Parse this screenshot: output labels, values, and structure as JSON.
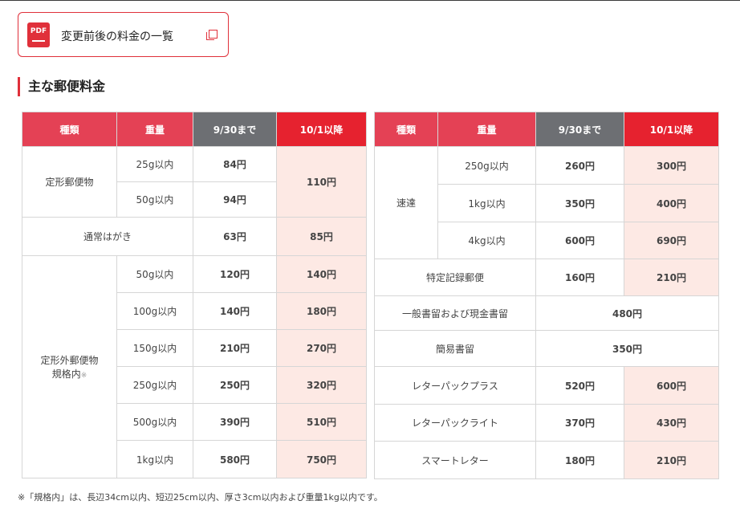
{
  "pdf_link": {
    "icon_text": "PDF",
    "label": "変更前後の料金の一覧"
  },
  "section": {
    "title": "主な郵便料金"
  },
  "headers": {
    "type": "種類",
    "weight": "重量",
    "old": "9/30まで",
    "new": "10/1以降"
  },
  "left": {
    "teikei": {
      "name": "定形郵便物",
      "rows": [
        {
          "weight": "25g以内",
          "old": "84円"
        },
        {
          "weight": "50g以内",
          "old": "94円"
        }
      ],
      "new": "110円"
    },
    "hagaki": {
      "name": "通常はがき",
      "old": "63円",
      "new": "85円"
    },
    "teikeigai": {
      "name_line1": "定形外郵便物",
      "name_line2": "規格内",
      "note_mark": "※",
      "rows": [
        {
          "weight": "50g以内",
          "old": "120円",
          "new": "140円"
        },
        {
          "weight": "100g以内",
          "old": "140円",
          "new": "180円"
        },
        {
          "weight": "150g以内",
          "old": "210円",
          "new": "270円"
        },
        {
          "weight": "250g以内",
          "old": "250円",
          "new": "320円"
        },
        {
          "weight": "500g以内",
          "old": "390円",
          "new": "510円"
        },
        {
          "weight": "1kg以内",
          "old": "580円",
          "new": "750円"
        }
      ]
    }
  },
  "right": {
    "sokutatsu": {
      "name": "速達",
      "rows": [
        {
          "weight": "250g以内",
          "old": "260円",
          "new": "300円"
        },
        {
          "weight": "1kg以内",
          "old": "350円",
          "new": "400円"
        },
        {
          "weight": "4kg以内",
          "old": "600円",
          "new": "690円"
        }
      ]
    },
    "tokutei": {
      "name": "特定記録郵便",
      "old": "160円",
      "new": "210円"
    },
    "ippan": {
      "name": "一般書留および現金書留",
      "price": "480円"
    },
    "kanni": {
      "name": "簡易書留",
      "price": "350円"
    },
    "letterpack_plus": {
      "name": "レターパックプラス",
      "old": "520円",
      "new": "600円"
    },
    "letterpack_light": {
      "name": "レターパックライト",
      "old": "370円",
      "new": "430円"
    },
    "smart_letter": {
      "name": "スマートレター",
      "old": "180円",
      "new": "210円"
    }
  },
  "footnote": "※「規格内」は、長辺34cm以内、短辺25cm以内、厚さ3cm以内および重量1kg以内です。",
  "colors": {
    "accent": "#e0303a",
    "header_red": "#e44155",
    "header_gray": "#6d6f73",
    "new_price_bg": "#fde9e4"
  }
}
